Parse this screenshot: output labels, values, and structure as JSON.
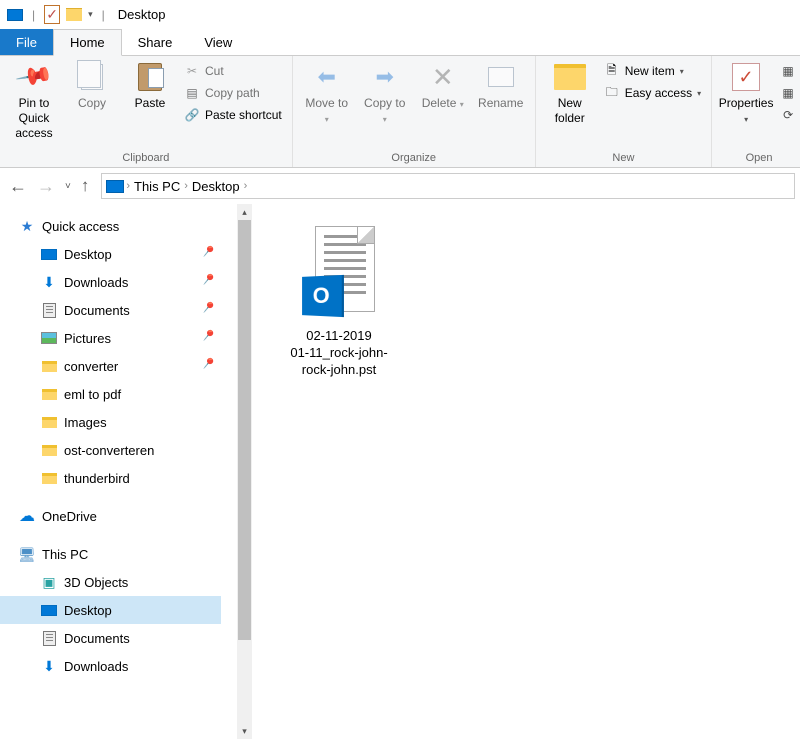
{
  "titlebar": {
    "title": "Desktop"
  },
  "tabs": {
    "file": "File",
    "home": "Home",
    "share": "Share",
    "view": "View"
  },
  "ribbon": {
    "clipboard": {
      "label": "Clipboard",
      "pin": "Pin to Quick access",
      "copy": "Copy",
      "paste": "Paste",
      "cut": "Cut",
      "copy_path": "Copy path",
      "paste_shortcut": "Paste shortcut"
    },
    "organize": {
      "label": "Organize",
      "move_to": "Move to",
      "copy_to": "Copy to",
      "delete": "Delete",
      "rename": "Rename"
    },
    "new": {
      "label": "New",
      "new_folder": "New folder",
      "new_item": "New item",
      "easy_access": "Easy access"
    },
    "open": {
      "label": "Open",
      "properties": "Properties"
    }
  },
  "breadcrumb": {
    "this_pc": "This PC",
    "desktop": "Desktop"
  },
  "nav": {
    "quick_access": "Quick access",
    "desktop": "Desktop",
    "downloads": "Downloads",
    "documents": "Documents",
    "pictures": "Pictures",
    "converter": "converter",
    "eml_to_pdf": "eml to pdf",
    "images": "Images",
    "ost": "ost-converteren",
    "thunderbird": "thunderbird",
    "onedrive": "OneDrive",
    "this_pc": "This PC",
    "objects3d": "3D Objects",
    "tp_desktop": "Desktop",
    "tp_documents": "Documents",
    "tp_downloads": "Downloads"
  },
  "files": {
    "pst": {
      "line1": "02-11-2019",
      "line2": "01-11_rock-john-",
      "line3": "rock-john.pst",
      "badge": "O"
    }
  }
}
